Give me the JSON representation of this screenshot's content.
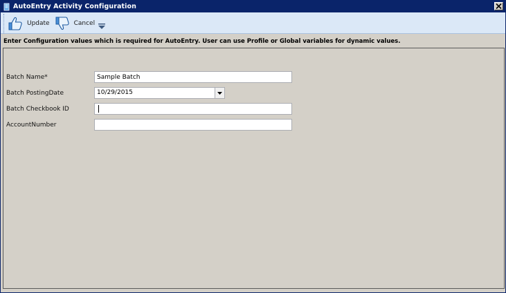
{
  "window": {
    "title": "AutoEntry Activity Configuration"
  },
  "toolbar": {
    "update_label": "Update",
    "cancel_label": "Cancel"
  },
  "instructions": "Enter Configuration values which is required for AutoEntry. User can use Profile or Global variables for dynamic values.",
  "form": {
    "batch_name": {
      "label": "Batch Name*",
      "value": "Sample Batch"
    },
    "batch_posting_date": {
      "label": "Batch PostingDate",
      "value": "10/29/2015"
    },
    "batch_checkbook_id": {
      "label": "Batch Checkbook ID",
      "value": ""
    },
    "account_number": {
      "label": "AccountNumber",
      "value": ""
    }
  },
  "icons": {
    "app": "document-icon",
    "update": "thumbs-up-icon",
    "cancel": "thumbs-down-icon",
    "overflow": "chevron-down-icon",
    "close": "close-icon",
    "dropdown": "dropdown-arrow-icon"
  },
  "colors": {
    "titlebar": "#0a246a",
    "ribbon": "#dbe8f7",
    "panel": "#d4d0c8"
  }
}
